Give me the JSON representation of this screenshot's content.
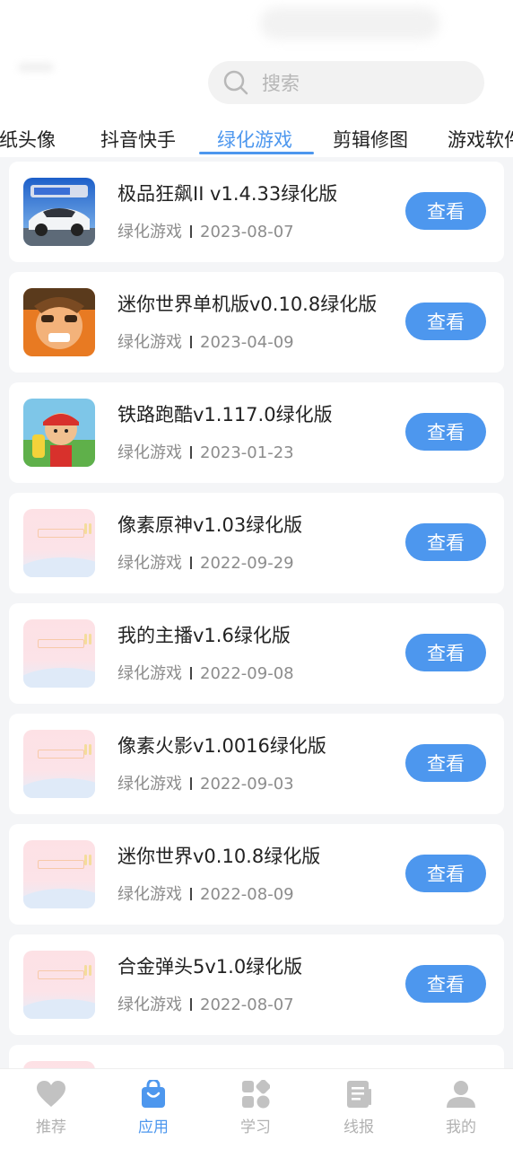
{
  "search": {
    "placeholder": "搜索"
  },
  "tabs": [
    {
      "label": "壁纸头像"
    },
    {
      "label": "抖音快手"
    },
    {
      "label": "绿化游戏"
    },
    {
      "label": "剪辑修图"
    },
    {
      "label": "游戏软件"
    }
  ],
  "active_tab": "绿化游戏",
  "items": [
    {
      "title": "极品狂飙II v1.4.33绿化版",
      "category": "绿化游戏",
      "date": "2023-08-07",
      "button": "查看",
      "icon": "car-racing-game-icon"
    },
    {
      "title": "迷你世界单机版v0.10.8绿化版",
      "category": "绿化游戏",
      "date": "2023-04-09",
      "button": "查看",
      "icon": "cartoon-character-game-icon"
    },
    {
      "title": "铁路跑酷v1.117.0绿化版",
      "category": "绿化游戏",
      "date": "2023-01-23",
      "button": "查看",
      "icon": "subway-runner-game-icon"
    },
    {
      "title": "像素原神v1.03绿化版",
      "category": "绿化游戏",
      "date": "2022-09-29",
      "button": "查看",
      "icon": "placeholder-image-icon"
    },
    {
      "title": "我的主播v1.6绿化版",
      "category": "绿化游戏",
      "date": "2022-09-08",
      "button": "查看",
      "icon": "placeholder-image-icon"
    },
    {
      "title": "像素火影v1.0016绿化版",
      "category": "绿化游戏",
      "date": "2022-09-03",
      "button": "查看",
      "icon": "placeholder-image-icon"
    },
    {
      "title": "迷你世界v0.10.8绿化版",
      "category": "绿化游戏",
      "date": "2022-08-09",
      "button": "查看",
      "icon": "placeholder-image-icon"
    },
    {
      "title": "合金弹头5v1.0绿化版",
      "category": "绿化游戏",
      "date": "2022-08-07",
      "button": "查看",
      "icon": "placeholder-image-icon"
    }
  ],
  "nav": [
    {
      "label": "推荐",
      "icon": "heart-icon"
    },
    {
      "label": "应用",
      "icon": "shopping-bag-icon"
    },
    {
      "label": "学习",
      "icon": "grid-apps-icon"
    },
    {
      "label": "线报",
      "icon": "document-icon"
    },
    {
      "label": "我的",
      "icon": "user-icon"
    }
  ],
  "active_nav": "应用",
  "colors": {
    "accent": "#4d97ee",
    "nav_inactive": "#b1b1b1",
    "background": "#f4f5f7"
  }
}
